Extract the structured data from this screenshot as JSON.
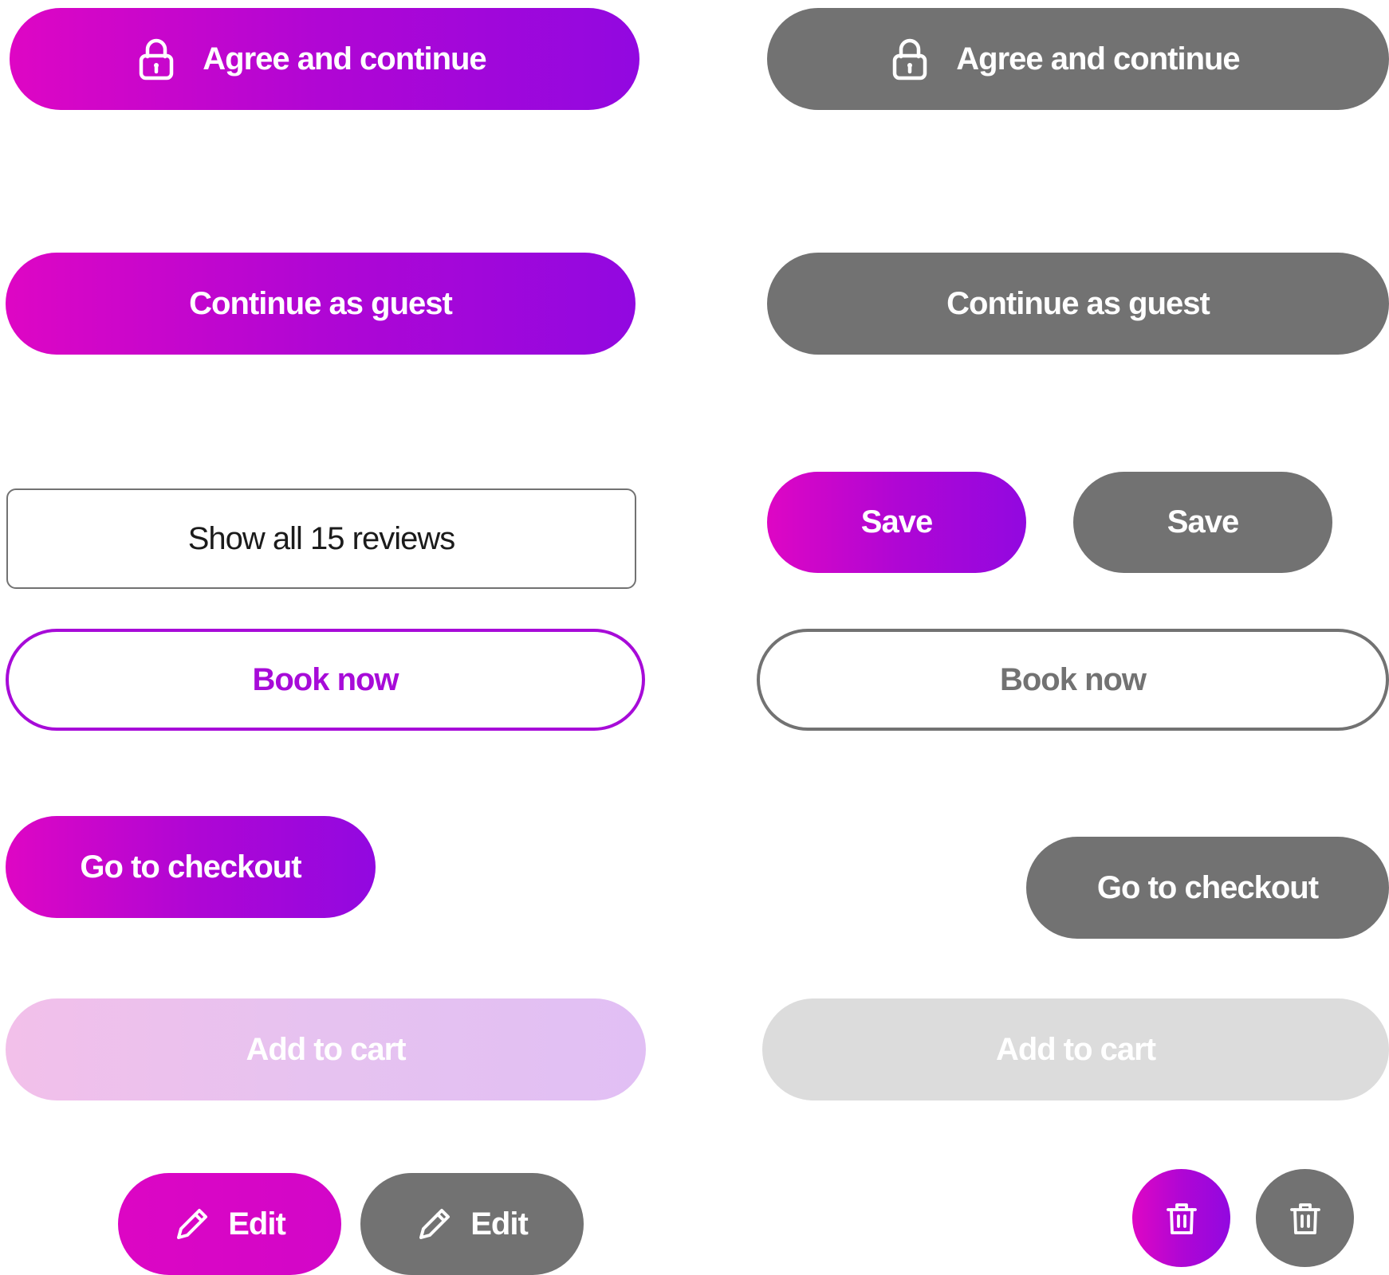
{
  "colors": {
    "gradient_start": "#de06c4",
    "gradient_end": "#9208e0",
    "grey": "#727272",
    "outline_purple": "#a70bd8",
    "disabled_grey": "#dcdcdc",
    "white": "#ffffff"
  },
  "buttons": {
    "agree_primary": {
      "label": "Agree and continue",
      "icon": "lock-icon"
    },
    "agree_secondary": {
      "label": "Agree and continue",
      "icon": "lock-icon"
    },
    "guest_primary": {
      "label": "Continue as guest"
    },
    "guest_secondary": {
      "label": "Continue as guest"
    },
    "show_reviews": {
      "label": "Show all 15 reviews"
    },
    "save_primary": {
      "label": "Save"
    },
    "save_secondary": {
      "label": "Save"
    },
    "book_primary": {
      "label": "Book now"
    },
    "book_secondary": {
      "label": "Book now"
    },
    "checkout_primary": {
      "label": "Go to checkout"
    },
    "checkout_secondary": {
      "label": "Go to checkout"
    },
    "cart_primary": {
      "label": "Add to cart",
      "state": "disabled"
    },
    "cart_secondary": {
      "label": "Add to cart",
      "state": "disabled"
    },
    "edit_primary": {
      "label": "Edit",
      "icon": "pencil-icon"
    },
    "edit_secondary": {
      "label": "Edit",
      "icon": "pencil-icon"
    },
    "delete_primary": {
      "icon": "trash-icon"
    },
    "delete_secondary": {
      "icon": "trash-icon"
    }
  }
}
